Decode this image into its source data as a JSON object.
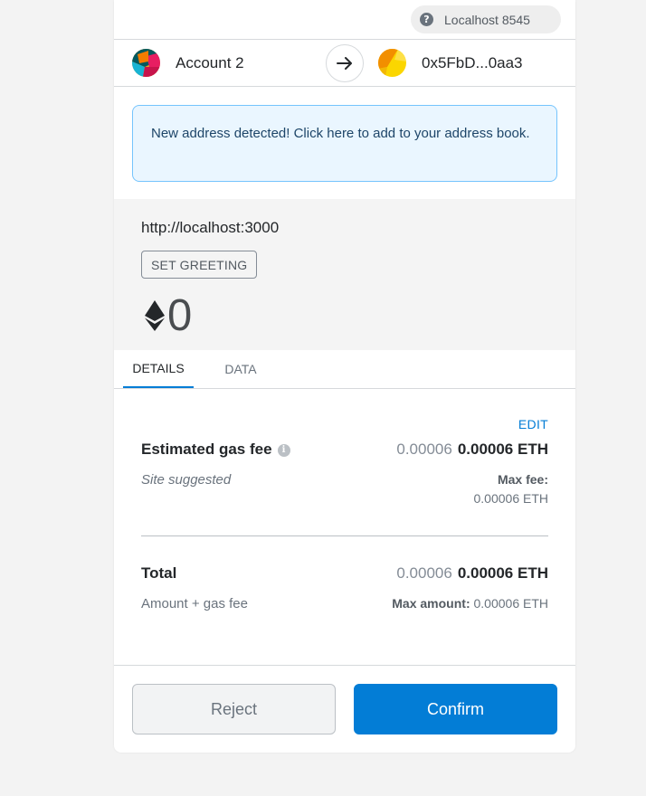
{
  "network": {
    "label": "Localhost 8545",
    "help_glyph": "?"
  },
  "from_account": {
    "name": "Account 2",
    "avatar_icon": "multicolor-jazzicon"
  },
  "to_account": {
    "address": "0x5FbD...0aa3",
    "avatar_icon": "orange-yellow-jazzicon"
  },
  "notice": {
    "text": "New address detected! Click here to add to your address book."
  },
  "origin": {
    "url": "http://localhost:3000",
    "method": "SET GREETING"
  },
  "amount": {
    "value": "0",
    "currency_icon": "ethereum-icon"
  },
  "tabs": [
    {
      "label": "DETAILS",
      "active": true
    },
    {
      "label": "DATA",
      "active": false
    }
  ],
  "gas": {
    "edit_label": "EDIT",
    "label": "Estimated gas fee",
    "info_glyph": "i",
    "secondary_value": "0.00006",
    "primary_value": "0.00006 ETH",
    "sub_label": "Site suggested",
    "max_fee_label": "Max fee:",
    "max_fee_value": "0.00006 ETH"
  },
  "total": {
    "label": "Total",
    "secondary_value": "0.00006",
    "primary_value": "0.00006 ETH",
    "sub_label": "Amount + gas fee",
    "max_amount_label": "Max amount:",
    "max_amount_value": "0.00006 ETH"
  },
  "footer": {
    "reject_label": "Reject",
    "confirm_label": "Confirm"
  },
  "colors": {
    "accent": "#037dd6",
    "notice_bg": "#eaf6ff",
    "notice_border": "#75c4fd"
  }
}
